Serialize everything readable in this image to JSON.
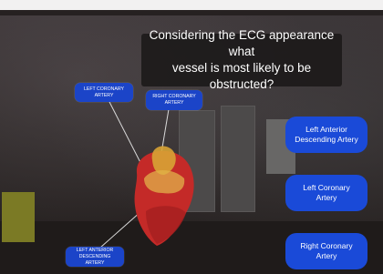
{
  "question": {
    "line1": "Considering the ECG appearance what",
    "line2": "vessel is most likely to be obstructed?"
  },
  "labels": {
    "left_coronary": {
      "line1": "LEFT CORONARY",
      "line2": "ARTERY"
    },
    "right_coronary": {
      "line1": "RIGHT CORONARY",
      "line2": "ARTERY"
    },
    "left_anterior_descending": {
      "line1": "LEFT ANTERIOR",
      "line2": "DESCENDING ARTERY"
    }
  },
  "answers": [
    {
      "line1": "Left Anterior",
      "line2": "Descending Artery"
    },
    {
      "line1": "Left Coronary",
      "line2": "Artery"
    },
    {
      "line1": "Right Coronary",
      "line2": "Artery"
    }
  ],
  "colors": {
    "label_bg": "#1b44c8",
    "answer_bg": "#1a4ad8",
    "question_bg": "#1c1a1a",
    "heart_red": "#c42a28",
    "heart_yellow": "#d8a334"
  }
}
